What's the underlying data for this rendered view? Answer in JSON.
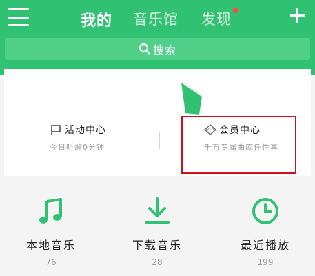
{
  "header": {
    "tabs": [
      {
        "label": "我的",
        "active": true
      },
      {
        "label": "音乐馆",
        "active": false
      },
      {
        "label": "发现",
        "active": false,
        "has_badge": true
      }
    ],
    "menu_icon": "hamburger-menu-icon",
    "add_icon": "plus-icon"
  },
  "search": {
    "label": "搜索",
    "icon": "search-icon"
  },
  "card": {
    "activity": {
      "title": "活动中心",
      "subtitle": "今日听歌0分钟",
      "icon": "flag-icon"
    },
    "vip": {
      "title": "会员中心",
      "subtitle": "千万专属曲库任性享",
      "icon": "vip-badge-icon"
    }
  },
  "shortcuts": [
    {
      "label": "本地音乐",
      "count": "76",
      "icon": "music-note-icon"
    },
    {
      "label": "下载音乐",
      "count": "28",
      "icon": "download-icon"
    },
    {
      "label": "最近播放",
      "count": "199",
      "icon": "clock-icon"
    }
  ],
  "colors": {
    "brand_green": "#30c272",
    "search_green": "#4fcf88",
    "highlight_red": "#d0101a",
    "badge_red": "#ff4a3d"
  }
}
